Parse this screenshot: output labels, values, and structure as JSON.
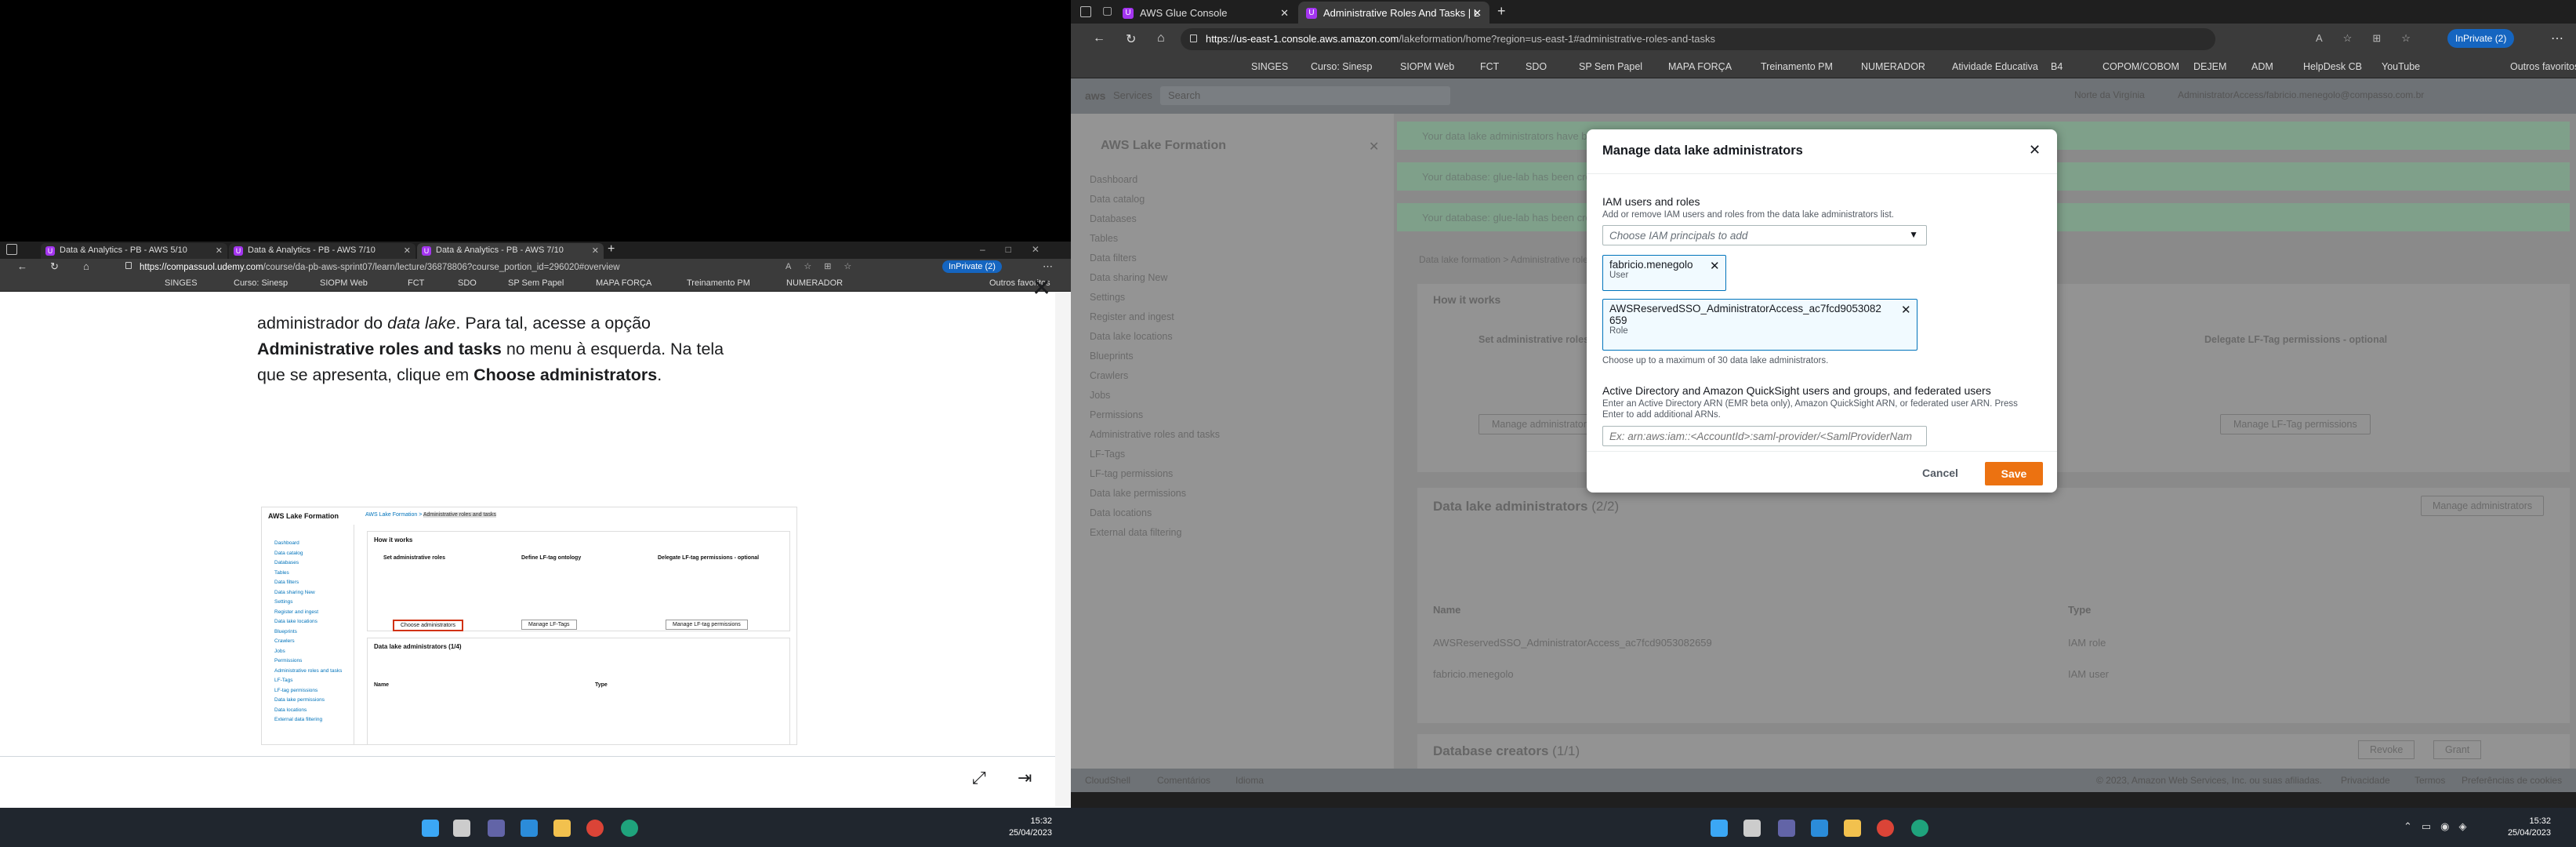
{
  "left_browser": {
    "tabs": [
      "Data & Analytics - PB - AWS 5/10",
      "Data & Analytics - PB - AWS 7/10",
      "Data & Analytics - PB - AWS 7/10"
    ],
    "url_host": "https://compassuol.udemy.com",
    "url_path": "/course/da-pb-aws-sprint07/learn/lecture/36878806?course_portion_id=296020#overview",
    "inprivate": "InPrivate (2)",
    "bookmarks": [
      "SINGES",
      "Curso: Sinesp",
      "SIOPM Web",
      "FCT",
      "SDO",
      "SP Sem Papel",
      "MAPA FORÇA",
      "Treinamento PM",
      "NUMERADOR",
      "Outros favoritos"
    ],
    "lesson": {
      "line1_a": "administrador do ",
      "line1_i": "data lake",
      "line1_b": ". Para tal, acesse a opção",
      "line2_b": "Administrative roles and tasks",
      "line2_c": " no menu à esquerda. Na tela",
      "line3_a": "que se apresenta, clique em ",
      "line3_b": "Choose administrators",
      "line3_c": "."
    },
    "thumb": {
      "title": "AWS Lake Formation",
      "crumb1": "AWS Lake Formation",
      "crumb2": "Administrative roles and tasks",
      "how": "How it works",
      "nav": [
        "Dashboard",
        "Data catalog",
        "Databases",
        "Tables",
        "Data filters",
        "Data sharing New",
        "Settings",
        "Register and ingest",
        "Data lake locations",
        "Blueprints",
        "Crawlers",
        "Jobs",
        "Permissions",
        "Administrative roles and tasks",
        "LF-Tags",
        "LF-tag permissions",
        "Data lake permissions",
        "Data locations",
        "External data filtering"
      ],
      "step1": "Set administrative roles",
      "step2": "Define LF-tag ontology",
      "step3": "Delegate LF-tag permissions - optional",
      "choose_btn": "Choose administrators",
      "manage_tags": "Manage LF-Tags",
      "manage_perm": "Manage LF-tag permissions",
      "dla": "Data lake administrators (1/4)",
      "col_name": "Name",
      "col_type": "Type"
    }
  },
  "left_taskbar": {
    "time": "15:32",
    "date": "25/04/2023"
  },
  "right_taskbar": {
    "time": "15:32",
    "date": "25/04/2023"
  },
  "right_browser": {
    "tabs": [
      "AWS Glue Console",
      "Administrative Roles And Tasks | L"
    ],
    "url_host": "https://us-east-1.console.aws.amazon.com",
    "url_path": "/lakeformation/home?region=us-east-1#administrative-roles-and-tasks",
    "inprivate": "InPrivate (2)",
    "bookmarks": [
      "SINGES",
      "Curso: Sinesp",
      "SIOPM Web",
      "FCT",
      "SDO",
      "SP Sem Papel",
      "MAPA FORÇA",
      "Treinamento PM",
      "NUMERADOR",
      "Atividade Educativa",
      "B4",
      "COPOM/COBOM",
      "DEJEM",
      "ADM",
      "HelpDesk CB",
      "YouTube",
      "Outros favoritos"
    ],
    "console": {
      "services": "Services",
      "search": "Search",
      "region": "Norte da Virgínia",
      "account": "AdministratorAccess/fabricio.menegolo@compasso.com.br",
      "side_title": "AWS Lake Formation",
      "side_items": [
        "Dashboard",
        "Data catalog",
        "Databases",
        "Tables",
        "Data filters",
        "Data sharing New",
        "Settings",
        "Register and ingest",
        "Data lake locations",
        "Blueprints",
        "Crawlers",
        "Jobs",
        "Permissions",
        "Administrative roles and tasks",
        "LF-Tags",
        "LF-tag permissions",
        "Data lake permissions",
        "Data locations",
        "External data filtering"
      ],
      "flash1": "Your data lake administrators have been updated successfully.",
      "flash2": "Your database: glue-lab has been created successfully.",
      "flash3": "Your database: glue-lab has been created successfully.",
      "crumb1": "Data lake formation",
      "crumb2": "Administrative roles and tasks",
      "how": "How it works",
      "step1": "Set administrative roles",
      "step3": "Delegate LF-Tag permissions - optional",
      "manage_admin": "Manage administrators",
      "manage_perm": "Manage LF-Tag permissions",
      "dla_title": "Data lake administrators",
      "dla_count": "(2/2)",
      "manage_admin2": "Manage administrators",
      "col_name": "Name",
      "col_type": "Type",
      "row1": "AWSReservedSSO_AdministratorAccess_ac7fcd9053082659",
      "row1_type": "IAM role",
      "row2": "fabricio.menegolo",
      "row2_type": "IAM user",
      "db_creators": "Database creators",
      "db_count": "(1/1)",
      "revoke": "Revoke",
      "grant": "Grant",
      "cloudshell": "CloudShell",
      "feedback": "Comentários",
      "language": "Idioma",
      "copyright": "© 2023, Amazon Web Services, Inc. ou suas afiliadas.",
      "privacy": "Privacidade",
      "terms": "Termos",
      "cookies": "Preferências de cookies"
    },
    "modal": {
      "title": "Manage data lake administrators",
      "iam_label": "IAM users and roles",
      "iam_desc": "Add or remove IAM users and roles from the data lake administrators list.",
      "iam_placeholder": "Choose IAM principals to add",
      "token1_name": "fabricio.menegolo",
      "token1_type": "User",
      "token2_name_1": "AWSReservedSSO_AdministratorAccess_ac7fcd9053082",
      "token2_name_2": "659",
      "token2_type": "Role",
      "limit_note": "Choose up to a maximum of 30 data lake administrators.",
      "ad_label": "Active Directory and Amazon QuickSight users and groups, and federated users",
      "ad_desc_1": "Enter an Active Directory ARN (EMR beta only), Amazon QuickSight ARN, or federated user ARN. Press",
      "ad_desc_2": "Enter to add additional ARNs.",
      "ad_placeholder": "Ex: arn:aws:iam::<AccountId>:saml-provider/<SamlProviderNam",
      "cancel": "Cancel",
      "save": "Save"
    }
  }
}
